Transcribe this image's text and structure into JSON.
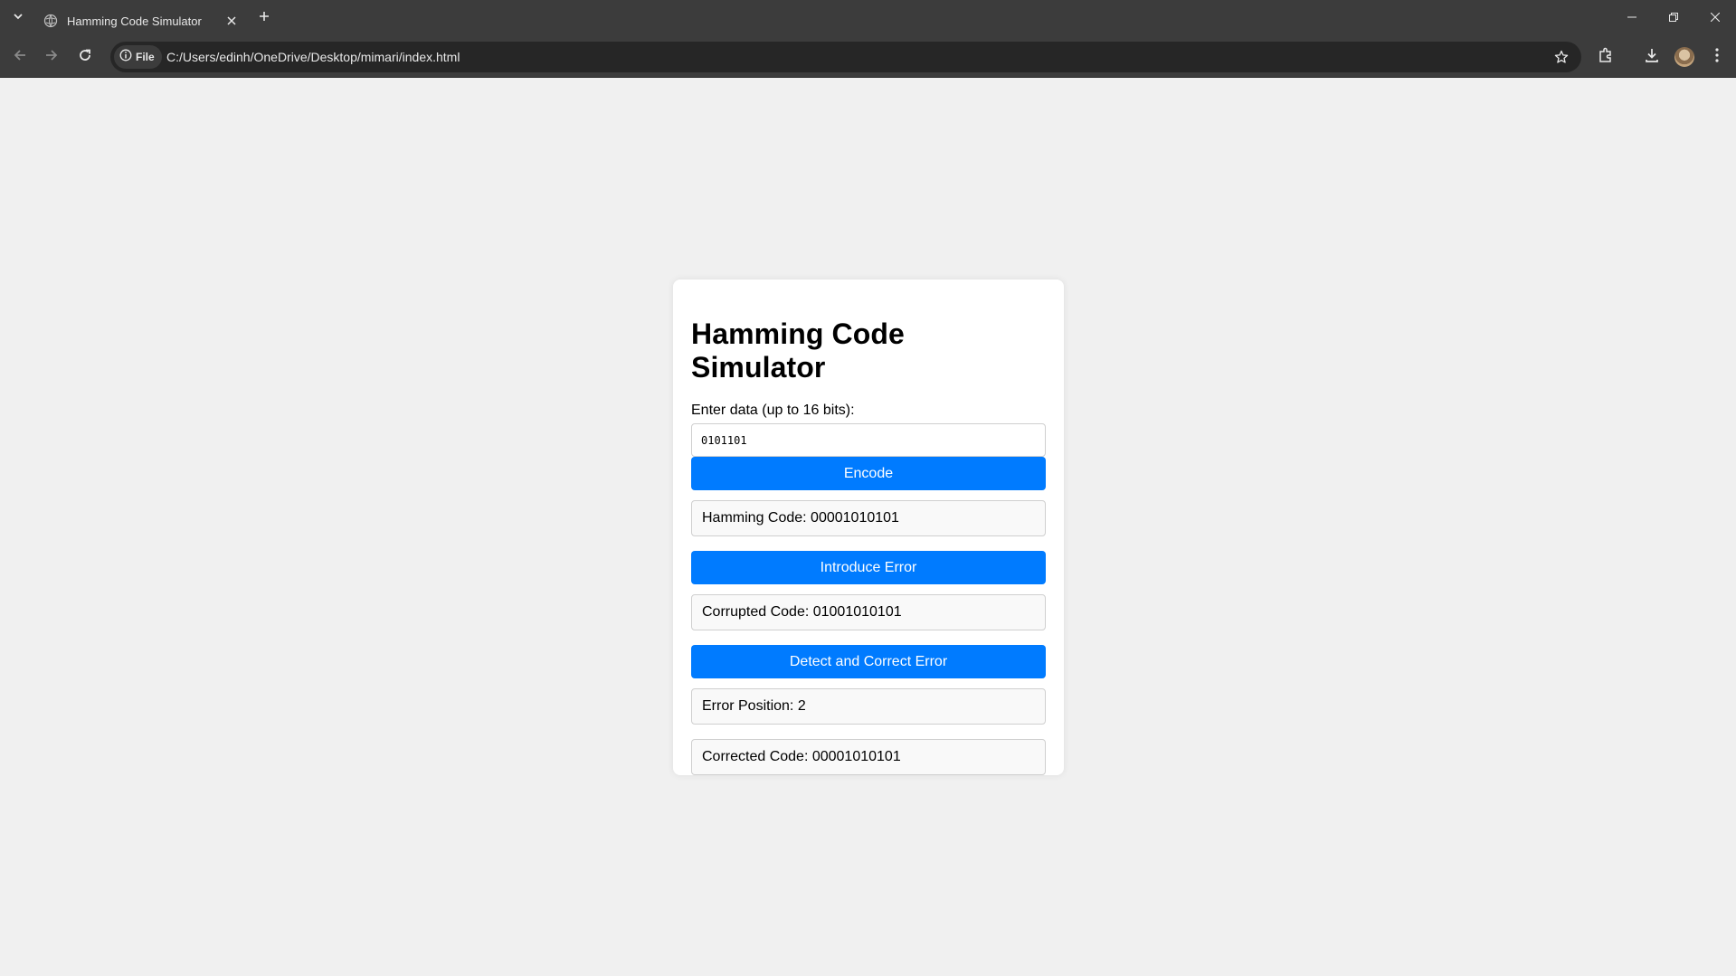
{
  "browser": {
    "tab_title": "Hamming Code Simulator",
    "site_chip_label": "File",
    "url": "C:/Users/edinh/OneDrive/Desktop/mimari/index.html",
    "icons": [
      "tab-list-icon",
      "globe-icon",
      "close-icon",
      "plus-icon",
      "minimize-icon",
      "restore-icon",
      "window-close-icon",
      "back-icon",
      "forward-icon",
      "reload-icon",
      "info-icon",
      "star-icon",
      "extensions-icon",
      "download-icon",
      "profile-avatar",
      "more-icon"
    ]
  },
  "app": {
    "title": "Hamming Code Simulator",
    "input_label": "Enter data (up to 16 bits):",
    "input_value": "0101101",
    "encode_label": "Encode",
    "hamming_code": "Hamming Code: 00001010101",
    "introduce_error_label": "Introduce Error",
    "corrupted_code": "Corrupted Code: 01001010101",
    "detect_label": "Detect and Correct Error",
    "error_position": "Error Position: 2",
    "corrected_code": "Corrected Code: 00001010101"
  },
  "colors": {
    "button": "#007bff",
    "page_background": "#f0f0f0",
    "chrome": "#3c3c3c"
  }
}
